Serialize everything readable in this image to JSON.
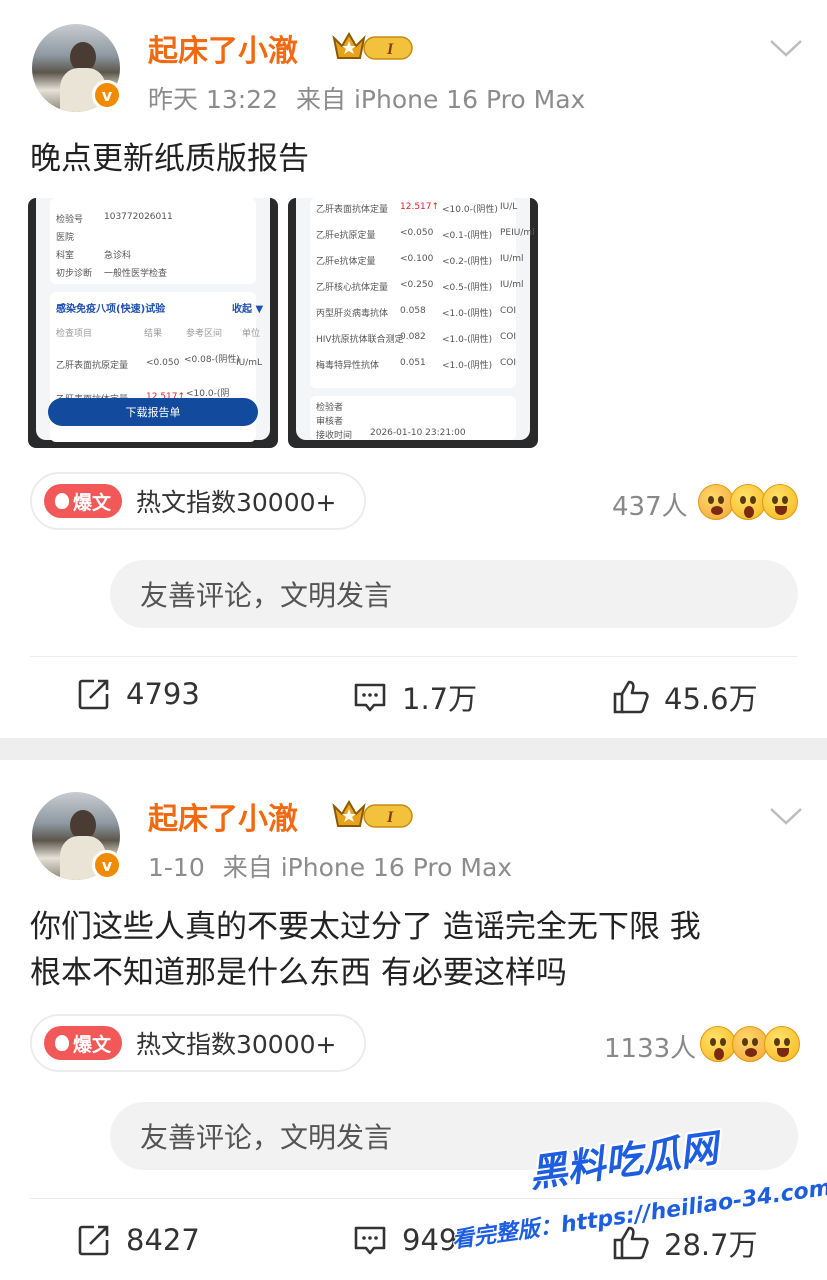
{
  "posts": [
    {
      "username": "起床了小澈",
      "time": "昨天 13:22",
      "source": "来自 iPhone 16 Pro Max",
      "text": "晚点更新纸质版报告",
      "hot_tag": "爆文",
      "hot_index": "热文指数30000+",
      "reaction_count": "437人",
      "comment_placeholder": "友善评论，文明发言",
      "reposts": "4793",
      "comments": "1.7万",
      "likes": "45.6万",
      "images": {
        "left": {
          "rows_top": [
            "检验号",
            "103772026011",
            "医院",
            "科室",
            "急诊科",
            "初步诊断",
            "一般性医学检查"
          ],
          "section_title": "感染免疫八项(快速)试验",
          "collapse": "收起 ▼",
          "headers": [
            "检查项目",
            "结果",
            "参考区间",
            "单位"
          ],
          "row1": [
            "乙肝表面抗原定量",
            "<0.050",
            "<0.08-(阴性)",
            "IU/mL"
          ],
          "row2": [
            "乙肝表面抗体定量",
            "12.517↑",
            "<10.0-(阴"
          ],
          "button": "下载报告单"
        },
        "right": {
          "rows": [
            [
              "乙肝表面抗体定量",
              "12.517↑",
              "<10.0-(阴性)",
              "IU/L"
            ],
            [
              "乙肝e抗原定量",
              "<0.050",
              "<0.1-(阴性)",
              "PEIU/ml"
            ],
            [
              "乙肝e抗体定量",
              "<0.100",
              "<0.2-(阴性)",
              "IU/ml"
            ],
            [
              "乙肝核心抗体定量",
              "<0.250",
              "<0.5-(阴性)",
              "IU/ml"
            ],
            [
              "丙型肝炎病毒抗体",
              "0.058",
              "<1.0-(阴性)",
              "COI"
            ],
            [
              "HIV抗原抗体联合测定",
              "0.082",
              "<1.0-(阴性)",
              "COI"
            ],
            [
              "梅毒特异性抗体",
              "0.051",
              "<1.0-(阴性)",
              "COI"
            ]
          ],
          "footer": [
            "检验者",
            "审核者",
            "接收时间",
            "2026-01-10 23:21:00"
          ]
        }
      }
    },
    {
      "username": "起床了小澈",
      "time": "1-10",
      "source": "来自 iPhone 16 Pro Max",
      "text_line1": "你们这些人真的不要太过分了 造谣完全无下限 我",
      "text_line2": "根本不知道那是什么东西 有必要这样吗",
      "hot_tag": "爆文",
      "hot_index": "热文指数30000+",
      "reaction_count": "1133人",
      "comment_placeholder": "友善评论，文明发言",
      "reposts": "8427",
      "comments": "949",
      "likes": "28.7万"
    }
  ],
  "watermark": {
    "title": "黑料吃瓜网",
    "subtitle": "看完整版：https://heiliao-34.com"
  },
  "colors": {
    "username": "#f06a12",
    "hot_tag": "#f25858",
    "verified": "#f08a00",
    "watermark": "#1d5de0"
  }
}
